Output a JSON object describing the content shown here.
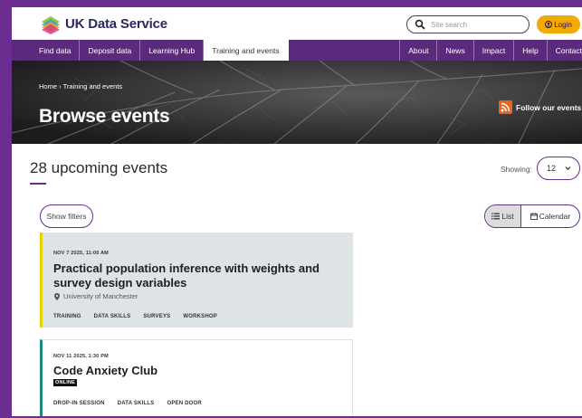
{
  "header": {
    "brand": "UK Data Service",
    "search_placeholder": "Site search",
    "login_label": "Login"
  },
  "nav": {
    "left": [
      "Find data",
      "Deposit data",
      "Learning Hub",
      "Training and events"
    ],
    "right": [
      "About",
      "News",
      "Impact",
      "Help",
      "Contact"
    ],
    "active": "Training and events"
  },
  "hero": {
    "breadcrumb_home": "Home",
    "breadcrumb_sep": "›",
    "breadcrumb_current": "Training and events",
    "title": "Browse events",
    "follow_label": "Follow our events"
  },
  "listing": {
    "count_text": "28 upcoming events",
    "showing_label": "Showing:",
    "showing_value": "12",
    "filters_label": "Show filters",
    "view_list_label": "List",
    "view_calendar_label": "Calendar"
  },
  "events": [
    {
      "date": "NOV 7 2025, 11:00 AM",
      "title": "Practical population inference with weights and survey design variables",
      "location": "University of Manchester",
      "tags": [
        "TRAINING",
        "DATA SKILLS",
        "SURVEYS",
        "WORKSHOP"
      ],
      "accent": "#e5d000"
    },
    {
      "date": "NOV 11 2025, 1:30 PM",
      "title": "Code Anxiety Club",
      "badge": "ONLINE",
      "tags": [
        "DROP-IN SESSION",
        "DATA SKILLS",
        "OPEN DOOR"
      ],
      "accent": "#1c8a7a"
    }
  ],
  "colors": {
    "brand_purple": "#6b2d8f",
    "nav_purple": "#5c2a7c",
    "login_gold": "#f2a900",
    "rss_orange": "#e8661c"
  }
}
